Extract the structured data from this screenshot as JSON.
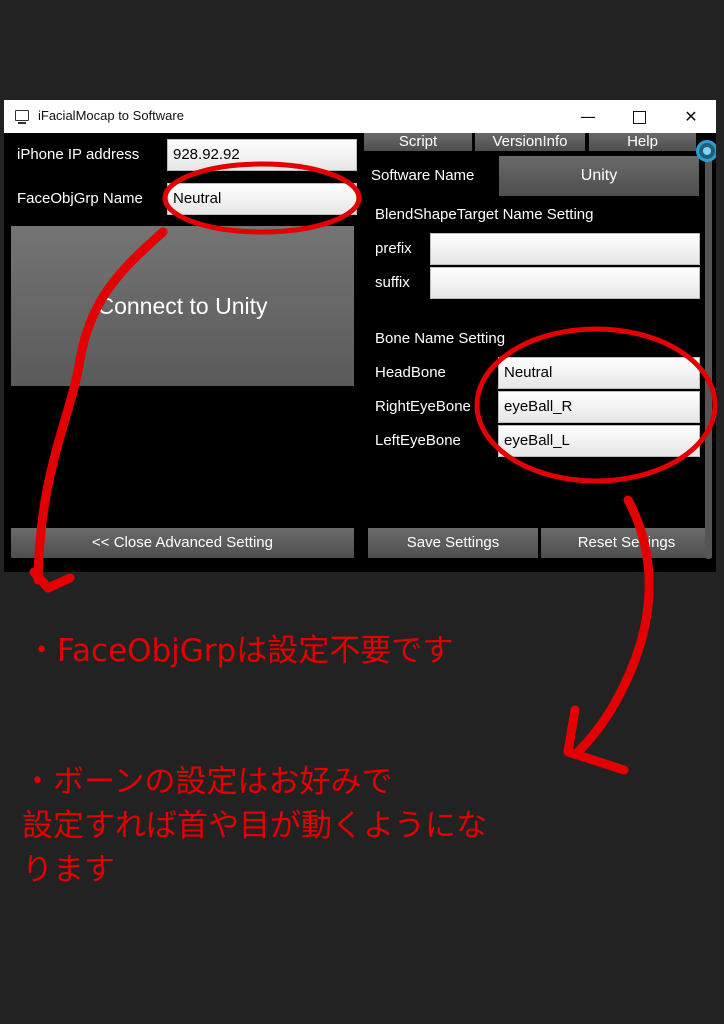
{
  "window": {
    "title": "iFacialMocap to Software",
    "controls": {
      "minimize": "—",
      "close": "✕"
    }
  },
  "left": {
    "ip_label": "iPhone IP address",
    "ip_value": "928.92.92",
    "faceobj_label": "FaceObjGrp Name",
    "faceobj_value": "Neutral",
    "connect_button": "Connect to Unity",
    "close_advanced_button": "<< Close Advanced Setting"
  },
  "tabs": [
    "Script",
    "VersionInfo",
    "Help"
  ],
  "right": {
    "software_name_label": "Software Name",
    "software_name_value": "Unity",
    "blendshape_heading": "BlendShapeTarget Name Setting",
    "prefix_label": "prefix",
    "prefix_value": "",
    "suffix_label": "suffix",
    "suffix_value": "",
    "bone_heading": "Bone Name Setting",
    "headbone_label": "HeadBone",
    "headbone_value": "Neutral",
    "righteye_label": "RightEyeBone",
    "righteye_value": "eyeBall_R",
    "lefteye_label": "LeftEyeBone",
    "lefteye_value": "eyeBall_L",
    "save_button": "Save Settings",
    "reset_button": "Reset Settings"
  },
  "annotations": {
    "note1": "・FaceObjGrpは設定不要です",
    "note2_line1": "・ボーンの設定はお好みで",
    "note2_line2": "設定すれば首や目が動くようにな",
    "note2_line3": "ります",
    "color": "#e30000"
  }
}
